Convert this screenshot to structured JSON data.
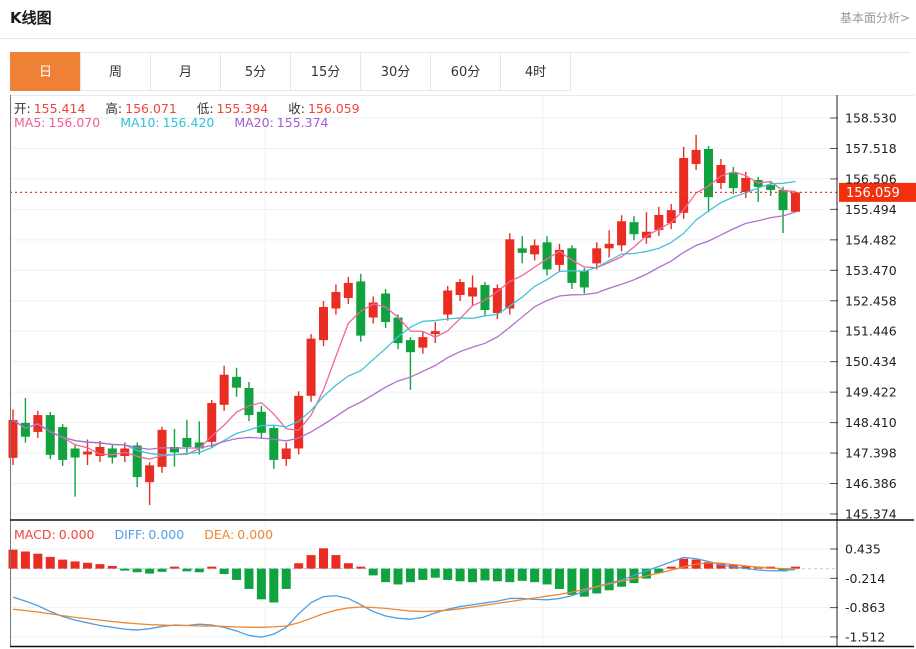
{
  "header": {
    "title": "K线图",
    "analysis_link": "基本面分析>"
  },
  "tabs": {
    "items": [
      {
        "label": "日",
        "active": true
      },
      {
        "label": "周",
        "active": false
      },
      {
        "label": "月",
        "active": false
      },
      {
        "label": "5分",
        "active": false
      },
      {
        "label": "15分",
        "active": false
      },
      {
        "label": "30分",
        "active": false
      },
      {
        "label": "60分",
        "active": false
      },
      {
        "label": "4时",
        "active": false
      }
    ]
  },
  "kline_legend": {
    "open_label": "开:",
    "open_value": "155.414",
    "high_label": "高:",
    "high_value": "156.071",
    "low_label": "低:",
    "low_value": "155.394",
    "close_label": "收:",
    "close_value": "156.059"
  },
  "ma_legend": {
    "ma5_label": "MA5:",
    "ma5_value": "156.070",
    "ma10_label": "MA10:",
    "ma10_value": "156.420",
    "ma20_label": "MA20:",
    "ma20_value": "155.374"
  },
  "macd_legend": {
    "macd_label": "MACD:",
    "macd_value": "0.000",
    "diff_label": "DIFF:",
    "diff_value": "0.000",
    "dea_label": "DEA:",
    "dea_value": "0.000"
  },
  "colors": {
    "up_red": "#ea2d23",
    "down_green": "#10a23e",
    "ma5": "#f0679a",
    "ma10": "#45c2d8",
    "ma20": "#b070cc",
    "diff_blue": "#4d9fe8",
    "dea_orange": "#f0862c",
    "badge_red": "#f2300e",
    "dashed_price": "#f03926",
    "zero_dashed": "#b5dff2",
    "tab_active": "#ee8136",
    "grid": "#edf1f5",
    "axis": "#222222"
  },
  "chart_data": [
    {
      "type": "candlestick",
      "title": "K线图",
      "period": "日",
      "y_ticks": [
        "158.530",
        "157.518",
        "156.506",
        "155.494",
        "154.482",
        "153.470",
        "152.458",
        "151.446",
        "150.434",
        "149.422",
        "148.410",
        "147.398",
        "146.386",
        "145.374"
      ],
      "current_price": 156.059,
      "current_price_label": "156.059",
      "ma_windows": [
        5,
        10,
        20
      ],
      "open": [
        147.24,
        148.4,
        148.1,
        148.66,
        148.26,
        147.55,
        147.35,
        147.3,
        147.55,
        147.3,
        147.65,
        146.43,
        146.94,
        147.6,
        147.9,
        147.75,
        147.77,
        149.0,
        149.93,
        149.56,
        148.77,
        148.23,
        147.2,
        147.55,
        149.3,
        151.15,
        152.2,
        152.55,
        153.1,
        151.9,
        152.7,
        151.9,
        151.15,
        150.9,
        151.35,
        152.0,
        152.65,
        152.6,
        152.98,
        152.05,
        152.2,
        154.2,
        154.0,
        154.4,
        153.65,
        154.2,
        153.45,
        153.7,
        154.2,
        154.3,
        155.07,
        154.55,
        154.81,
        155.04,
        155.38,
        157.0,
        157.5,
        156.37,
        156.7,
        156.07,
        156.47,
        156.3,
        156.14,
        155.414
      ],
      "close": [
        148.5,
        147.94,
        148.66,
        147.34,
        147.17,
        147.25,
        147.45,
        147.6,
        147.25,
        147.55,
        146.6,
        146.99,
        148.17,
        147.42,
        147.6,
        147.55,
        149.06,
        150.0,
        149.57,
        148.66,
        148.07,
        147.17,
        147.55,
        149.3,
        151.2,
        152.25,
        152.75,
        153.05,
        151.3,
        152.4,
        151.75,
        151.05,
        150.75,
        151.25,
        151.45,
        152.8,
        153.08,
        152.9,
        152.15,
        152.88,
        154.5,
        154.05,
        154.3,
        153.5,
        154.15,
        153.05,
        152.9,
        154.2,
        154.35,
        155.1,
        154.67,
        154.75,
        155.31,
        155.47,
        157.2,
        157.47,
        155.9,
        156.97,
        156.2,
        156.54,
        156.24,
        156.14,
        155.47,
        156.059
      ],
      "low": [
        147.0,
        147.74,
        147.9,
        147.2,
        146.97,
        145.95,
        147.0,
        147.1,
        147.05,
        147.1,
        146.27,
        145.67,
        146.74,
        146.95,
        147.4,
        147.35,
        147.57,
        148.8,
        149.27,
        148.46,
        147.87,
        146.87,
        146.97,
        147.35,
        149.1,
        150.95,
        152.0,
        152.35,
        151.1,
        151.7,
        151.55,
        150.85,
        149.5,
        150.7,
        151.05,
        151.8,
        152.45,
        152.3,
        151.95,
        151.85,
        152.0,
        153.7,
        153.8,
        153.3,
        153.45,
        152.85,
        152.7,
        153.5,
        153.9,
        154.1,
        154.47,
        154.35,
        154.61,
        154.84,
        155.18,
        156.8,
        155.4,
        156.17,
        156.0,
        155.87,
        155.74,
        155.94,
        154.71,
        155.394
      ],
      "high": [
        148.85,
        149.23,
        148.8,
        148.76,
        148.36,
        147.7,
        147.85,
        147.8,
        147.7,
        147.75,
        147.75,
        147.09,
        148.27,
        148.2,
        148.5,
        148.45,
        149.16,
        150.3,
        150.23,
        149.76,
        148.97,
        148.33,
        147.75,
        149.45,
        151.35,
        152.45,
        153.0,
        153.25,
        153.35,
        152.6,
        152.85,
        152.0,
        151.25,
        151.45,
        151.75,
        152.95,
        153.18,
        153.3,
        153.08,
        153.0,
        154.7,
        154.6,
        154.5,
        154.6,
        154.35,
        154.3,
        153.55,
        154.4,
        154.8,
        155.3,
        155.27,
        155.4,
        155.58,
        155.67,
        157.57,
        157.97,
        157.6,
        157.17,
        156.9,
        156.74,
        156.57,
        156.44,
        156.24,
        156.071
      ],
      "x_gridlines": [
        265,
        543,
        782
      ],
      "grid": true,
      "legend_position": "top-left"
    },
    {
      "type": "bar",
      "name": "MACD",
      "y_ticks": [
        "0.435",
        "-0.214",
        "-0.863",
        "-1.512"
      ],
      "hist": [
        0.42,
        0.38,
        0.33,
        0.26,
        0.2,
        0.16,
        0.13,
        0.1,
        0.06,
        -0.04,
        -0.08,
        -0.11,
        -0.07,
        0.03,
        -0.06,
        -0.08,
        0.04,
        -0.12,
        -0.25,
        -0.45,
        -0.68,
        -0.75,
        -0.45,
        0.12,
        0.3,
        0.45,
        0.3,
        0.12,
        0.04,
        -0.15,
        -0.3,
        -0.35,
        -0.3,
        -0.25,
        -0.2,
        -0.25,
        -0.28,
        -0.3,
        -0.26,
        -0.28,
        -0.3,
        -0.27,
        -0.3,
        -0.35,
        -0.45,
        -0.58,
        -0.62,
        -0.55,
        -0.48,
        -0.4,
        -0.32,
        -0.22,
        -0.1,
        0.04,
        0.22,
        0.2,
        0.15,
        0.12,
        0.08,
        0.05,
        0.03,
        0.02,
        -0.06,
        0.0
      ],
      "diff": [
        -0.63,
        -0.72,
        -0.82,
        -0.95,
        -1.06,
        -1.14,
        -1.2,
        -1.26,
        -1.3,
        -1.34,
        -1.36,
        -1.33,
        -1.28,
        -1.25,
        -1.26,
        -1.23,
        -1.25,
        -1.3,
        -1.38,
        -1.48,
        -1.52,
        -1.45,
        -1.3,
        -1.0,
        -0.75,
        -0.62,
        -0.6,
        -0.66,
        -0.8,
        -0.95,
        -1.05,
        -1.1,
        -1.12,
        -1.08,
        -0.98,
        -0.9,
        -0.84,
        -0.8,
        -0.76,
        -0.72,
        -0.66,
        -0.66,
        -0.68,
        -0.69,
        -0.66,
        -0.6,
        -0.5,
        -0.4,
        -0.32,
        -0.25,
        -0.15,
        -0.05,
        0.05,
        0.15,
        0.25,
        0.22,
        0.16,
        0.08,
        0.04,
        0.0,
        -0.03,
        -0.05,
        -0.04,
        -0.02
      ],
      "dea": [
        -0.9,
        -0.93,
        -0.96,
        -1.0,
        -1.04,
        -1.08,
        -1.11,
        -1.14,
        -1.17,
        -1.2,
        -1.22,
        -1.24,
        -1.25,
        -1.26,
        -1.26,
        -1.27,
        -1.27,
        -1.28,
        -1.29,
        -1.3,
        -1.3,
        -1.29,
        -1.27,
        -1.2,
        -1.1,
        -1.0,
        -0.92,
        -0.87,
        -0.85,
        -0.86,
        -0.88,
        -0.91,
        -0.94,
        -0.95,
        -0.94,
        -0.92,
        -0.89,
        -0.85,
        -0.81,
        -0.77,
        -0.73,
        -0.69,
        -0.65,
        -0.61,
        -0.57,
        -0.52,
        -0.46,
        -0.4,
        -0.34,
        -0.28,
        -0.22,
        -0.16,
        -0.1,
        -0.03,
        0.04,
        0.1,
        0.13,
        0.12,
        0.09,
        0.06,
        0.03,
        0.01,
        0.0,
        0.0
      ],
      "zero_line_dashed": true,
      "grid": true
    }
  ]
}
